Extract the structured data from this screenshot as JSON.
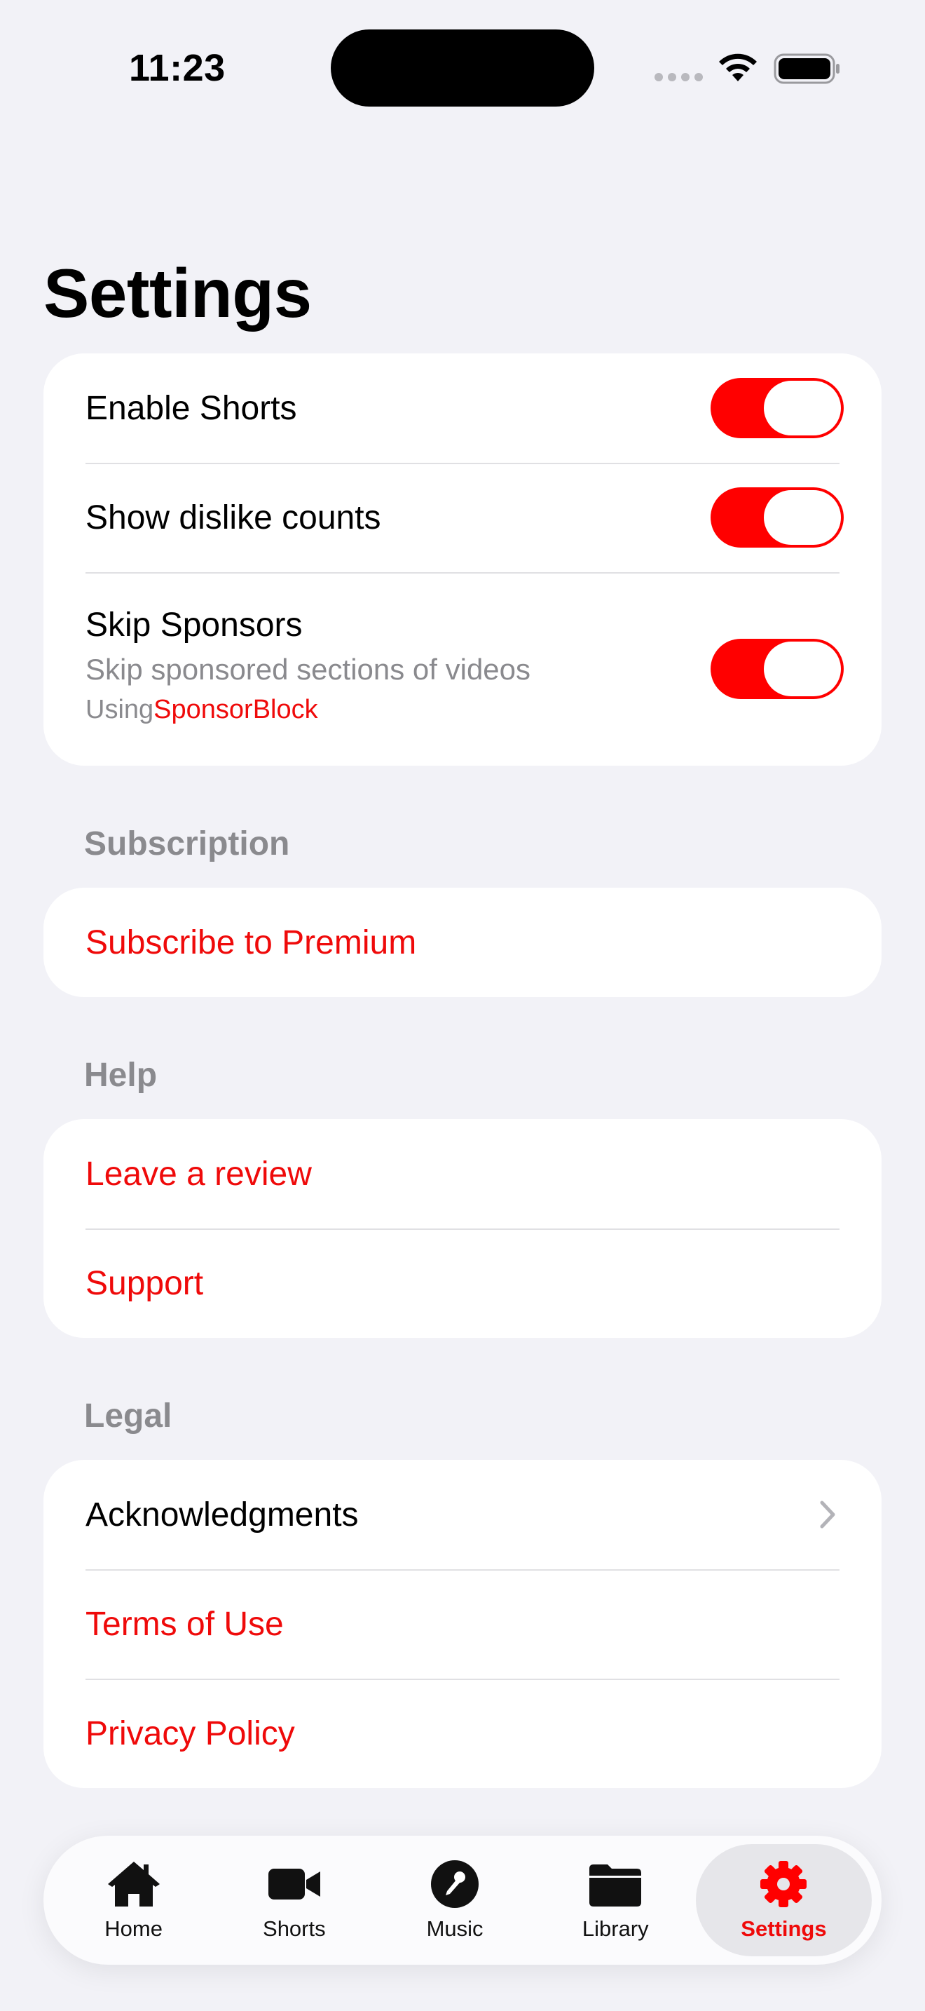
{
  "status_bar": {
    "time": "11:23"
  },
  "title": "Settings",
  "toggles": {
    "enable_shorts": {
      "label": "Enable Shorts",
      "on": true
    },
    "show_dislikes": {
      "label": "Show dislike counts",
      "on": true
    },
    "skip_sponsors": {
      "label": "Skip Sponsors",
      "subtitle": "Skip sponsored sections of videos",
      "using_prefix": "Using",
      "using_link": "SponsorBlock",
      "on": true
    }
  },
  "subscription": {
    "header": "Subscription",
    "subscribe": "Subscribe to Premium"
  },
  "help": {
    "header": "Help",
    "review": "Leave a review",
    "support": "Support"
  },
  "legal": {
    "header": "Legal",
    "acknowledgments": "Acknowledgments",
    "terms": "Terms of Use",
    "privacy": "Privacy Policy"
  },
  "tabs": [
    {
      "label": "Home",
      "icon": "house-icon"
    },
    {
      "label": "Shorts",
      "icon": "video-camera-icon"
    },
    {
      "label": "Music",
      "icon": "microphone-icon"
    },
    {
      "label": "Library",
      "icon": "folder-icon"
    },
    {
      "label": "Settings",
      "icon": "gear-icon",
      "active": true
    }
  ],
  "colors": {
    "accent": "#ff0000",
    "background": "#f2f2f7",
    "secondary_text": "#8a8a8e"
  }
}
